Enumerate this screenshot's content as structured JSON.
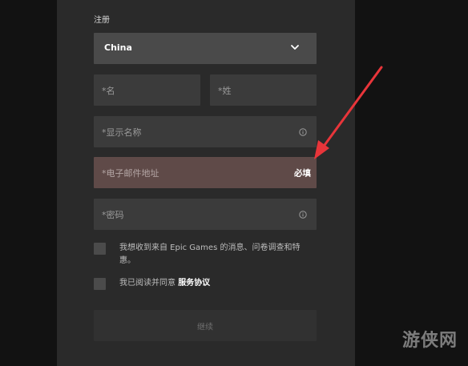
{
  "form": {
    "heading": "注册",
    "country": {
      "value": "China",
      "icon": "chevron-down-icon"
    },
    "first_name": {
      "placeholder": "*名"
    },
    "last_name": {
      "placeholder": "*姓"
    },
    "display_name": {
      "placeholder": "*显示名称",
      "icon": "info-icon"
    },
    "email": {
      "placeholder": "*电子邮件地址",
      "error": "必填",
      "error_color": "#5f4a48"
    },
    "password": {
      "placeholder": "*密码",
      "icon": "info-icon"
    },
    "newsletter_checkbox": {
      "label": "我想收到来自 Epic Games 的消息、问卷调查和特惠。",
      "checked": false
    },
    "terms_checkbox": {
      "label_prefix": "我已阅读并同意",
      "link": "服务协议",
      "checked": false
    },
    "continue_label": "继续"
  },
  "annotation": {
    "color": "#e8353a",
    "icon": "red-arrow-icon"
  },
  "watermark": {
    "text": "游侠网"
  }
}
